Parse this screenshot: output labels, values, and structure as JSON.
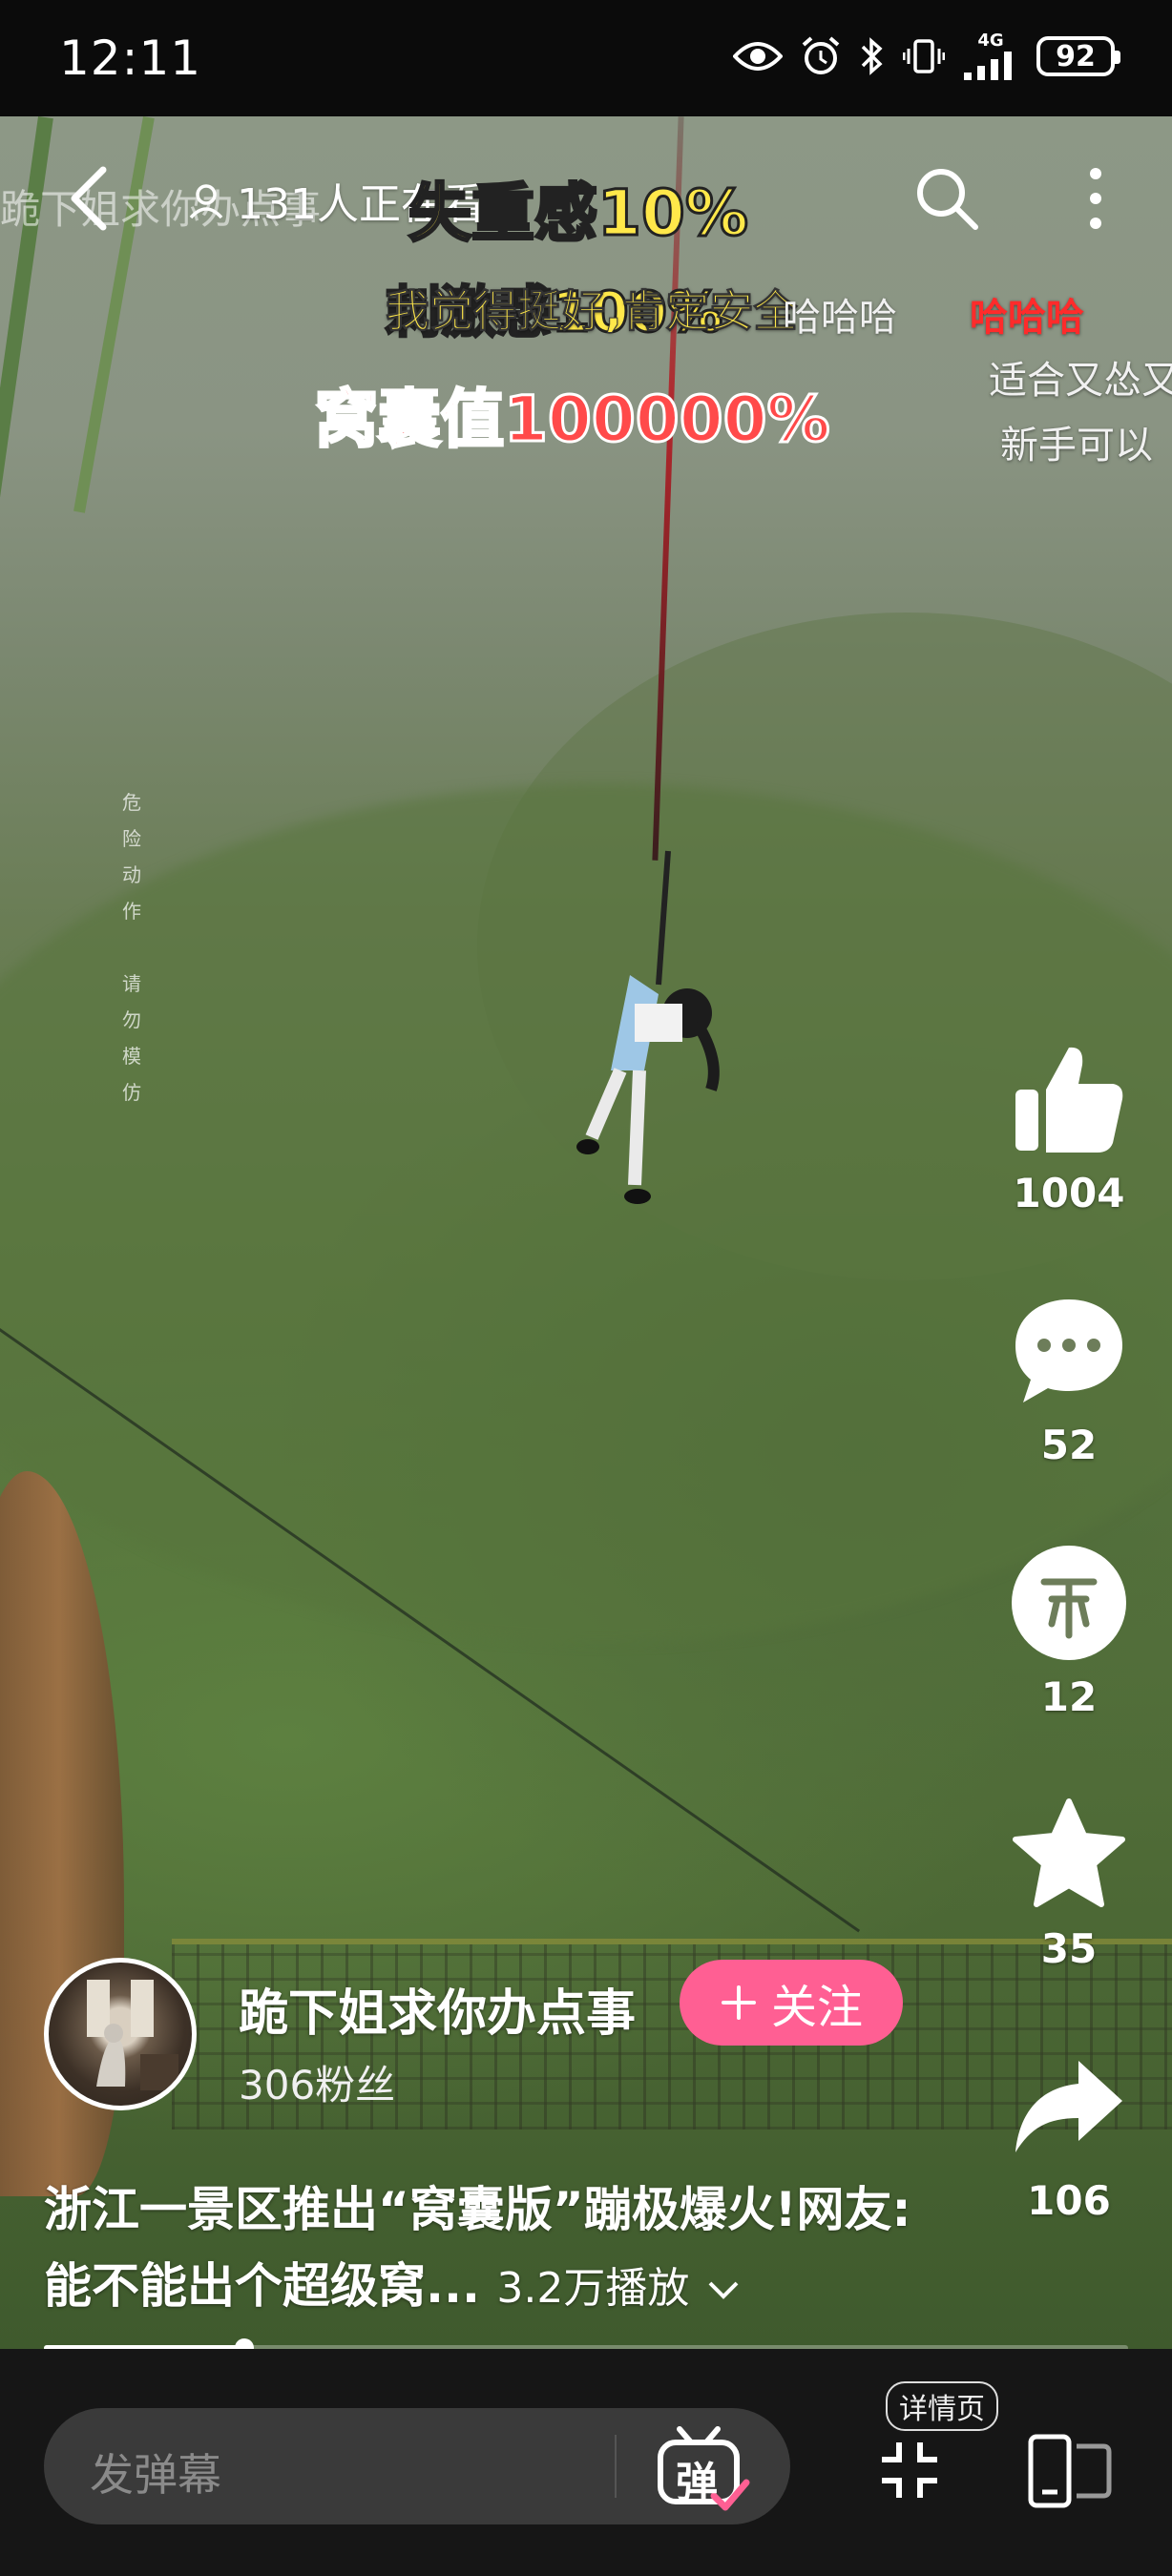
{
  "status_bar": {
    "time": "12:11",
    "network": "4G",
    "battery": "92",
    "icons": [
      "eye-icon",
      "alarm-icon",
      "bluetooth-icon",
      "vibrate-icon",
      "signal-icon",
      "battery-icon"
    ]
  },
  "top_bar": {
    "viewers": "131人正在看",
    "icons": [
      "back-arrow-icon",
      "person-icon",
      "search-icon",
      "more-vertical-icon"
    ]
  },
  "video": {
    "captions": [
      "失重感10%",
      "刺激感100%",
      "窝囊值100000%"
    ],
    "overlay_danmaku": "我觉得挺好,肯定安全",
    "danmaku": [
      {
        "text": "哈哈哈",
        "color": "#f1f1f1"
      },
      {
        "text": "哈哈哈",
        "color": "#ff2b2b"
      },
      {
        "text": "适合又怂又",
        "color": "#f1f1f1"
      },
      {
        "text": "新手可以",
        "color": "#f1f1f1"
      }
    ],
    "ghost_danmaku": "跪下姐求你办点事",
    "warning_text": "危险动作 请勿模仿"
  },
  "actions": {
    "like_count": "1004",
    "comment_count": "52",
    "coin_count": "12",
    "favorite_count": "35",
    "share_count": "106"
  },
  "author": {
    "name": "跪下姐求你办点事",
    "fans": "306粉丝",
    "follow_label": "关注"
  },
  "video_info": {
    "title": "浙江一景区推出“窝囊版”蹦极爆火!网友:能不能出个超级窝...",
    "views": "3.2万播放"
  },
  "playback": {
    "progress_fraction": 0.185
  },
  "bottom_bar": {
    "danmaku_placeholder": "发弹幕",
    "danmaku_toggle_label": "弹",
    "details_label": "详情页"
  },
  "colors": {
    "accent_pink": "#ff5f93",
    "danmaku_red": "#ff2b2b",
    "caption_yellow": "#ffe84a"
  }
}
